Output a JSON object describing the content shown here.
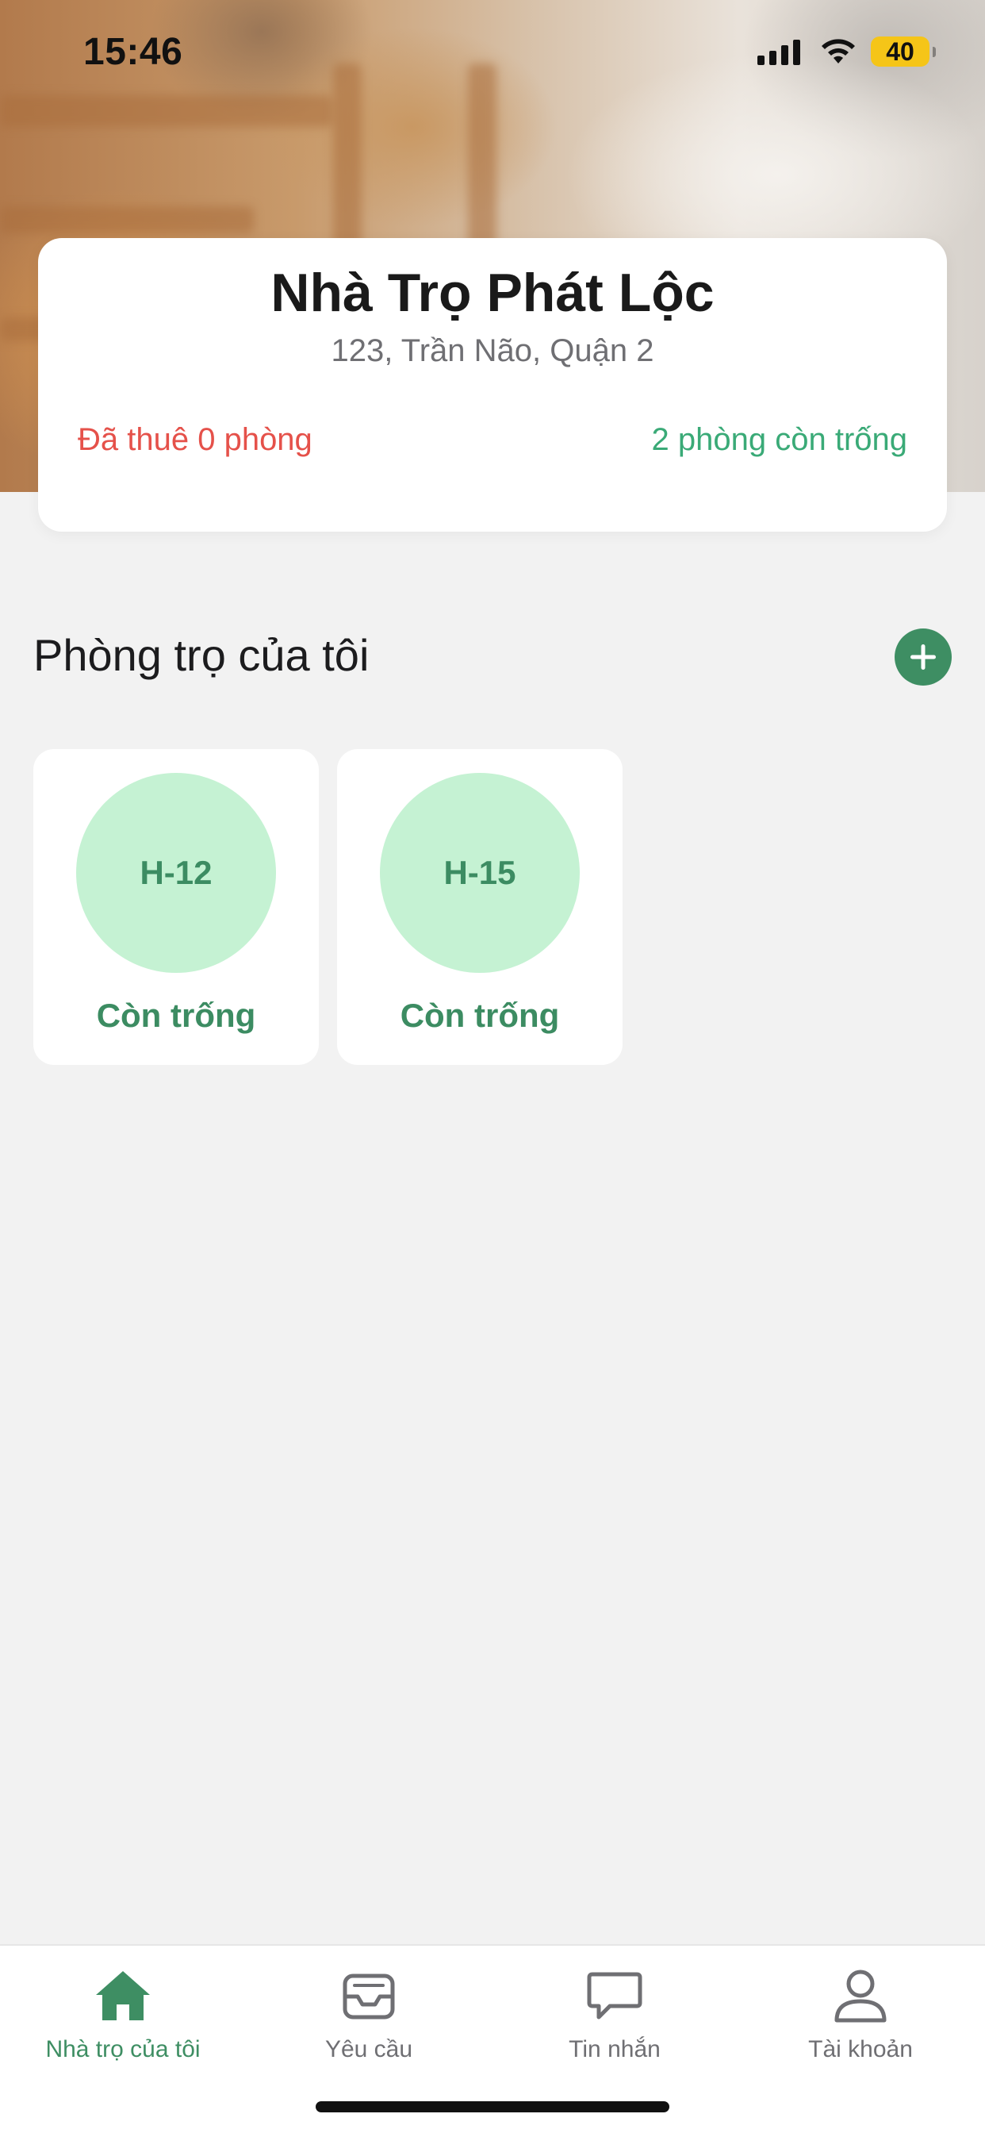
{
  "status_bar": {
    "time": "15:46",
    "battery": "40",
    "icons": [
      "cellular-signal-icon",
      "wifi-icon",
      "battery-icon"
    ]
  },
  "property": {
    "name": "Nhà Trọ Phát Lộc",
    "address": "123, Trần Não, Quận 2",
    "rented_text": "Đã thuê 0 phòng",
    "vacant_text": "2 phòng còn trống"
  },
  "section": {
    "title": "Phòng trọ của tôi",
    "add_icon": "plus-icon"
  },
  "rooms": [
    {
      "code": "H-12",
      "status": "Còn trống"
    },
    {
      "code": "H-15",
      "status": "Còn trống"
    }
  ],
  "tabs": [
    {
      "label": "Nhà trọ của tôi",
      "icon": "home-icon",
      "active": true
    },
    {
      "label": "Yêu cầu",
      "icon": "inbox-icon",
      "active": false
    },
    {
      "label": "Tin nhắn",
      "icon": "chat-bubble-icon",
      "active": false
    },
    {
      "label": "Tài khoản",
      "icon": "user-icon",
      "active": false
    }
  ],
  "colors": {
    "accent": "#3e8e63",
    "rented": "#e5514a",
    "vacant": "#3aaa77",
    "room_circle": "#c5f2d3",
    "background": "#f2f2f2"
  }
}
